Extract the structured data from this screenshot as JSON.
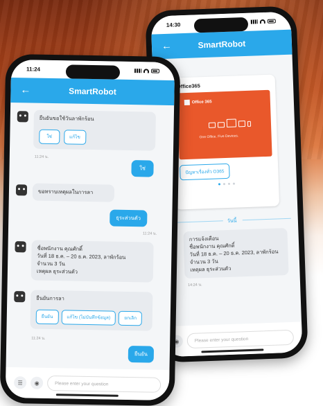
{
  "colors": {
    "primary": "#2aa8ea",
    "bubble": "#e8ebef",
    "office": "#e9582b"
  },
  "front": {
    "time": "11:24",
    "title": "SmartRobot",
    "messages": {
      "bot1_text": "ยืนยันขอใช้วันลาพักร้อน",
      "bot1_chip_yes": "ใช่",
      "bot1_chip_no": "แก้ไข",
      "ts1": "11:24 น.",
      "user1": "ใช่",
      "bot2_text": "ขอทราบเหตุผลในการลา",
      "user2": "ธุระส่วนตัว",
      "ts2": "11:24 น.",
      "bot3_line1": "ชื่อพนักงาน คุณศักดิ์",
      "bot3_line2": "วันที่ 18 ธ.ค. – 20 ธ.ค. 2023, ลาพักร้อน",
      "bot3_line3": "จำนวน 3 วัน",
      "bot3_line4": "เหตุผล ธุระส่วนตัว",
      "bot4_title": "ยืนยันการลา",
      "bot4_chip1": "ยืนยัน",
      "bot4_chip2": "แก้ไข (ไม่บันทึกข้อมูล)",
      "bot4_chip3": "ยกเลิก",
      "ts3": "11:24 น.",
      "user3": "ยืนยัน"
    },
    "composer_placeholder": "Please enter your question"
  },
  "back": {
    "time": "14:30",
    "title": "SmartRobot",
    "card_title": "Office365",
    "office_brand": "Office 365",
    "office_sub": "One Office. Five Devices.",
    "card_button": "ปัญหาเรื่องทั่ว O365",
    "divider_label": "วันนี้",
    "notice_line1": "การแจ้งเตือน",
    "notice_line2": "ชื่อพนักงาน คุณศักดิ์",
    "notice_line3": "วันที่ 18 ธ.ค. – 20 ธ.ค. 2023, ลาพักร้อน",
    "notice_line4": "จำนวน 3 วัน",
    "notice_line5": "เหตุผล ธุระส่วนตัว",
    "ts_notice": "14:24 น.",
    "composer_placeholder": "Please enter your question"
  }
}
